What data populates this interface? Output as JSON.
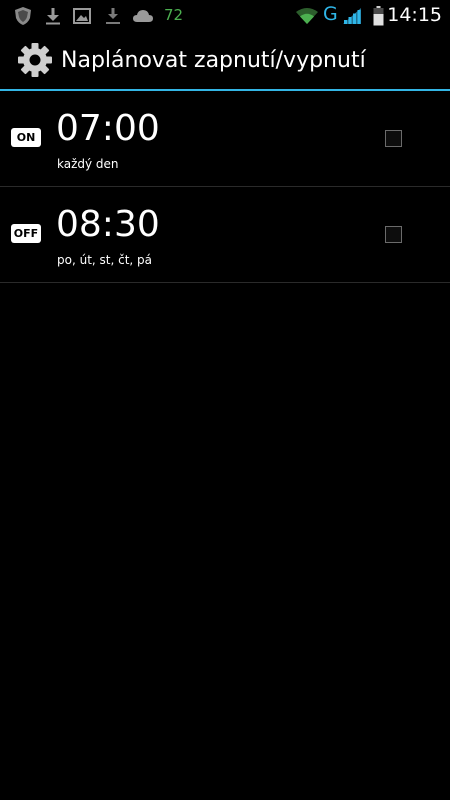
{
  "status_bar": {
    "notification_count": "72",
    "network_type": "G",
    "time": "14:15",
    "icons": [
      "shield-app-icon",
      "download-icon",
      "image-icon",
      "download-complete-icon",
      "cloud-icon",
      "wifi-icon",
      "signal-icon",
      "battery-icon"
    ],
    "colors": {
      "count": "#4caf50",
      "network": "#2fb6e8"
    }
  },
  "action_bar": {
    "title": "Naplánovat zapnutí/vypnutí",
    "icon": "gear-icon",
    "accent_color": "#33b5e5"
  },
  "schedules": [
    {
      "badge": "ON",
      "time": "07:00",
      "days": "každý den",
      "checked": false
    },
    {
      "badge": "OFF",
      "time": "08:30",
      "days": "po, út, st, čt, pá",
      "checked": false
    }
  ]
}
